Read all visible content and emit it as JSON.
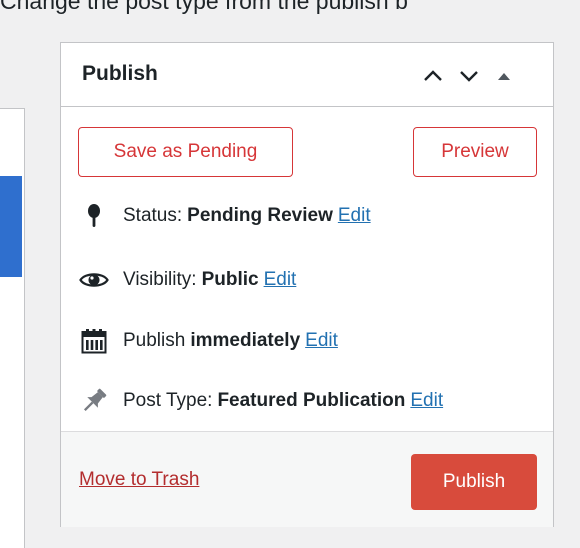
{
  "caption": "Change the post type from the publish b",
  "publish_box": {
    "title": "Publish",
    "controls": {
      "move_up_icon": "chevron-up-icon",
      "move_down_icon": "chevron-down-icon",
      "toggle_icon": "triangle-up-icon"
    },
    "actions": {
      "save_pending_label": "Save as Pending",
      "preview_label": "Preview"
    },
    "status": {
      "label": "Status:",
      "value": "Pending Review",
      "edit_label": "Edit",
      "icon": "pin-icon"
    },
    "visibility": {
      "label": "Visibility:",
      "value": "Public",
      "edit_label": "Edit",
      "icon": "eye-icon"
    },
    "schedule": {
      "label": "Publish",
      "value": "immediately",
      "edit_label": "Edit",
      "icon": "calendar-icon"
    },
    "post_type": {
      "label": "Post Type:",
      "value": "Featured Publication",
      "edit_label": "Edit",
      "icon": "thumbtack-icon"
    },
    "footer": {
      "trash_label": "Move to Trash",
      "publish_label": "Publish"
    }
  },
  "colors": {
    "accent_red": "#d63638",
    "publish_button": "#d84b3c",
    "link_blue": "#2271b1",
    "trash_red": "#b32d2e"
  }
}
